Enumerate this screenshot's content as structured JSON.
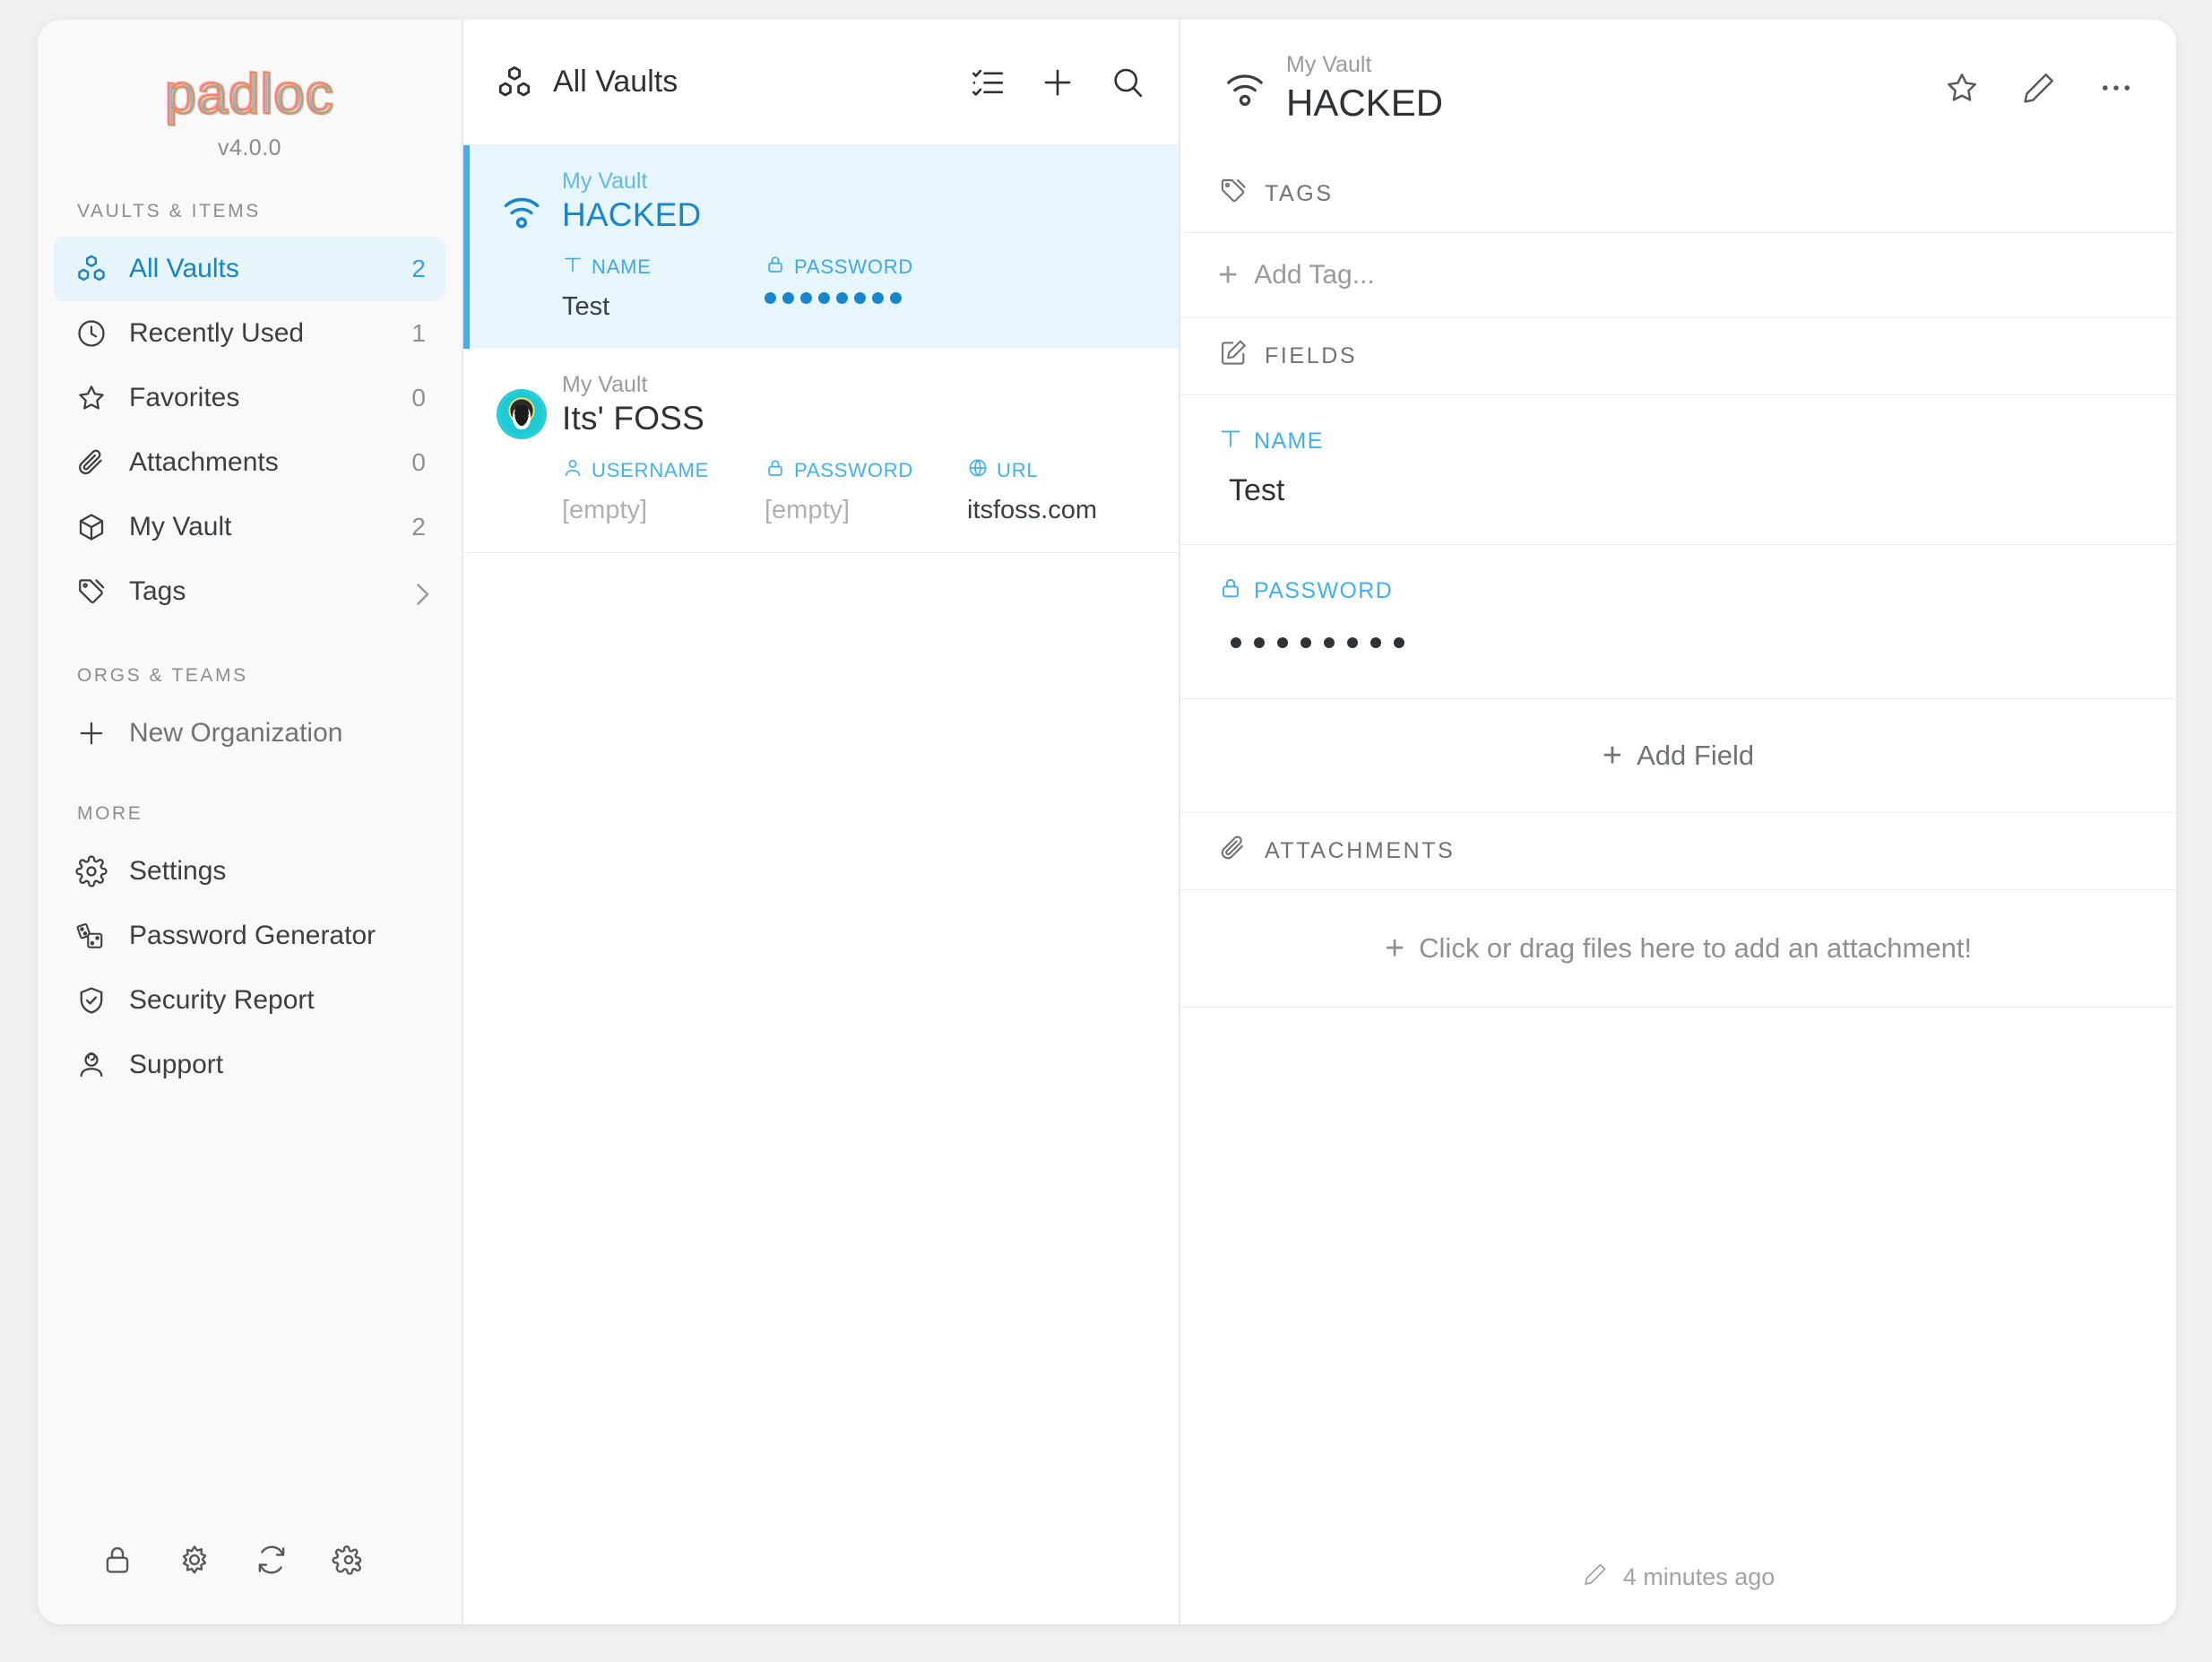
{
  "app": {
    "logo_text": "padloc",
    "version": "v4.0.0"
  },
  "sidebar": {
    "sections": {
      "vaults_items": "VAULTS & ITEMS",
      "orgs_teams": "ORGS & TEAMS",
      "more": "MORE"
    },
    "items": [
      {
        "label": "All Vaults",
        "count": "2",
        "icon": "cubes-icon",
        "active": true
      },
      {
        "label": "Recently Used",
        "count": "1",
        "icon": "clock-icon",
        "active": false
      },
      {
        "label": "Favorites",
        "count": "0",
        "icon": "star-icon",
        "active": false
      },
      {
        "label": "Attachments",
        "count": "0",
        "icon": "paperclip-icon",
        "active": false
      },
      {
        "label": "My Vault",
        "count": "2",
        "icon": "cube-icon",
        "active": false
      },
      {
        "label": "Tags",
        "count": "",
        "icon": "tag-icon",
        "active": false
      }
    ],
    "new_organization": "New Organization",
    "more_items": [
      {
        "label": "Settings",
        "icon": "gear-icon"
      },
      {
        "label": "Password Generator",
        "icon": "dice-icon"
      },
      {
        "label": "Security Report",
        "icon": "shield-check-icon"
      },
      {
        "label": "Support",
        "icon": "support-person-icon"
      }
    ],
    "bottom_buttons": [
      {
        "icon": "lock-icon"
      },
      {
        "icon": "sun-icon"
      },
      {
        "icon": "sync-icon"
      },
      {
        "icon": "gear-icon"
      }
    ]
  },
  "list": {
    "header_title": "All Vaults",
    "header_icon": "cubes-icon",
    "actions": [
      {
        "icon": "checklist-icon"
      },
      {
        "icon": "plus-icon"
      },
      {
        "icon": "search-icon"
      }
    ],
    "items": [
      {
        "vault": "My Vault",
        "name": "HACKED",
        "icon": "broadcast-icon",
        "selected": true,
        "fields": [
          {
            "label": "NAME",
            "icon": "text-icon",
            "value": "Test",
            "masked": false
          },
          {
            "label": "PASSWORD",
            "icon": "lock-icon",
            "value": "••••••••",
            "masked": true,
            "dots": 8
          }
        ]
      },
      {
        "vault": "My Vault",
        "name": "Its' FOSS",
        "icon": "favicon-tux",
        "selected": false,
        "fields": [
          {
            "label": "USERNAME",
            "icon": "user-icon",
            "value": "[empty]",
            "masked": false,
            "empty": true
          },
          {
            "label": "PASSWORD",
            "icon": "lock-icon",
            "value": "[empty]",
            "masked": false,
            "empty": true
          },
          {
            "label": "URL",
            "icon": "globe-icon",
            "value": "itsfoss.com",
            "masked": false,
            "empty": false
          }
        ]
      }
    ]
  },
  "detail": {
    "vault": "My Vault",
    "name": "HACKED",
    "icon": "broadcast-icon",
    "actions": [
      {
        "icon": "star-icon"
      },
      {
        "icon": "pencil-icon"
      },
      {
        "icon": "more-horizontal-icon"
      }
    ],
    "tags_section": {
      "title": "TAGS",
      "icon": "tag-icon",
      "add_label": "Add Tag...",
      "plus": "+"
    },
    "fields_section": {
      "title": "FIELDS",
      "icon": "edit-square-icon",
      "fields": [
        {
          "label": "NAME",
          "icon": "text-icon",
          "value": "Test",
          "masked": false
        },
        {
          "label": "PASSWORD",
          "icon": "lock-icon",
          "value": "•••••••••",
          "masked": true,
          "dots": 8
        }
      ],
      "add_field_label": "Add Field",
      "plus": "+"
    },
    "attachments_section": {
      "title": "ATTACHMENTS",
      "icon": "paperclip-icon",
      "drop_label": "Click or drag files here to add an attachment!",
      "plus": "+"
    },
    "footer": {
      "icon": "pencil-icon",
      "timestamp": "4 minutes ago"
    }
  },
  "colors": {
    "accent_blue": "#1787c9",
    "bright_blue": "#3fb1f0",
    "selected_bg": "#e7f5fd",
    "sidebar_bg": "#f9f9f9",
    "page_bg": "#f0f0f0",
    "logo_orange": "#f08a5d"
  }
}
